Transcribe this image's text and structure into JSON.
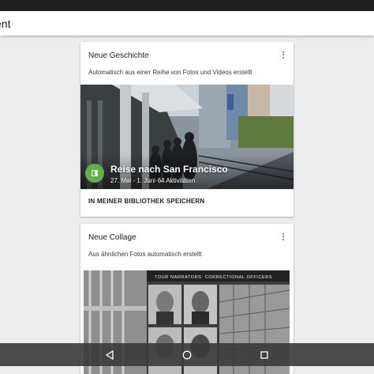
{
  "app_bar": {
    "title": "ent"
  },
  "cards": [
    {
      "title": "Neue Geschichte",
      "subtitle": "Automatisch aus einer Reihe von Fotos und Videos erstellt",
      "menu_icon": "more-vert-icon",
      "photo": {
        "story_title": "Reise nach San Francisco",
        "story_dates": "27. Mai - 1. Juni·64 Aktivitäten",
        "badge_icon": "book-icon",
        "badge_color": "#5fb246"
      },
      "action_label": "IN MEINER BIBLIOTHEK SPEICHERN"
    },
    {
      "title": "Neue Collage",
      "subtitle": "Aus ähnlichen Fotos automatisch erstellt",
      "menu_icon": "more-vert-icon",
      "photo": {
        "banner_text": "TOUR NARRATORS: CORRECTIONAL OFFICERS"
      }
    }
  ],
  "nav_bar": {
    "back_icon": "back-triangle-icon",
    "home_icon": "home-circle-icon",
    "recents_icon": "recents-square-icon"
  }
}
